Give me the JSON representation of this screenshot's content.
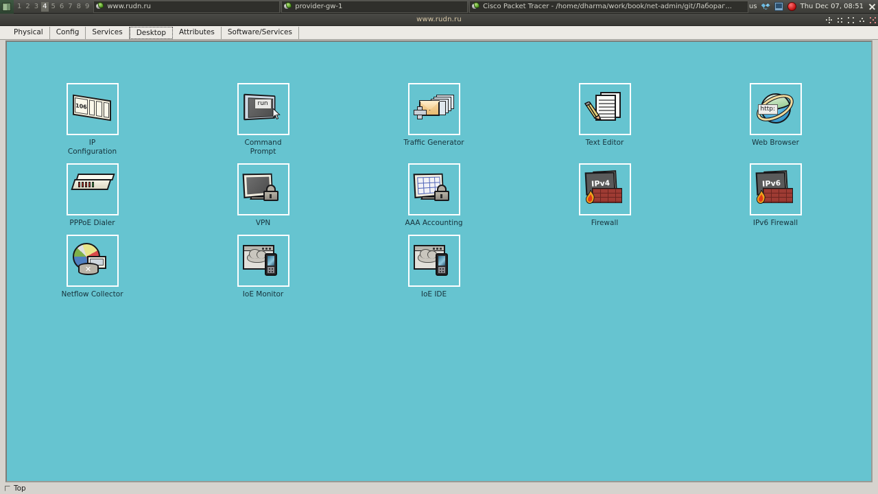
{
  "taskbar": {
    "launcher_icon": "menu-launcher-icon",
    "desktops": [
      "1",
      "2",
      "3",
      "4",
      "5",
      "6",
      "7",
      "8",
      "9"
    ],
    "active_desktop": "4",
    "windows": [
      {
        "icon": "packet-tracer-icon",
        "title": "www.rudn.ru"
      },
      {
        "icon": "packet-tracer-icon",
        "title": "provider-gw-1"
      },
      {
        "icon": "packet-tracer-icon",
        "title": "Cisco Packet Tracer - /home/dharma/work/book/net-admin/git/Лабораг..."
      }
    ],
    "tray": {
      "keyboard_layout": "us",
      "dropbox_icon": "dropbox-icon",
      "display_icon": "display-icon",
      "record_icon": "record-icon",
      "clock": "Thu Dec 07, 08:51",
      "close_icon": "close-icon"
    }
  },
  "window": {
    "title": "www.rudn.ru",
    "controls": [
      {
        "name": "shade-button",
        "icon": "shade-icon"
      },
      {
        "name": "minimize-button",
        "icon": "minimize-icon"
      },
      {
        "name": "maximize-button",
        "icon": "maximize-icon"
      },
      {
        "name": "restore-button",
        "icon": "restore-icon"
      },
      {
        "name": "close-button",
        "icon": "close-icon"
      }
    ]
  },
  "tabs": [
    {
      "label": "Physical",
      "active": false
    },
    {
      "label": "Config",
      "active": false
    },
    {
      "label": "Services",
      "active": false
    },
    {
      "label": "Desktop",
      "active": true
    },
    {
      "label": "Attributes",
      "active": false
    },
    {
      "label": "Software/Services",
      "active": false
    }
  ],
  "desktop": {
    "background_color": "#66c4d0",
    "rows": [
      [
        {
          "label": "IP\nConfiguration",
          "icon": "ip-configuration-icon",
          "badge": "106"
        },
        {
          "label": "Command\nPrompt",
          "icon": "command-prompt-icon",
          "badge": "run"
        },
        {
          "label": "Traffic Generator",
          "icon": "traffic-generator-icon"
        },
        {
          "label": "Text Editor",
          "icon": "text-editor-icon"
        },
        {
          "label": "Web Browser",
          "icon": "web-browser-icon",
          "badge": "http:"
        }
      ],
      [
        {
          "label": "PPPoE Dialer",
          "icon": "pppoe-dialer-icon"
        },
        {
          "label": "VPN",
          "icon": "vpn-icon"
        },
        {
          "label": "AAA Accounting",
          "icon": "aaa-accounting-icon"
        },
        {
          "label": "Firewall",
          "icon": "firewall-icon",
          "badge": "IPv4"
        },
        {
          "label": "IPv6 Firewall",
          "icon": "ipv6-firewall-icon",
          "badge": "IPv6"
        }
      ],
      [
        {
          "label": "Netflow Collector",
          "icon": "netflow-collector-icon"
        },
        {
          "label": "IoE Monitor",
          "icon": "ioe-monitor-icon"
        },
        {
          "label": "IoE IDE",
          "icon": "ioe-ide-icon"
        }
      ]
    ]
  },
  "statusbar": {
    "top_label": "Top",
    "top_checked": false
  },
  "colors": {
    "desktop_bg": "#66c4d0",
    "chrome_bg": "#d6d3ce",
    "taskbar_bg": "#44443f",
    "title_text": "#d9c9a8",
    "icon_label": "#16313a"
  }
}
